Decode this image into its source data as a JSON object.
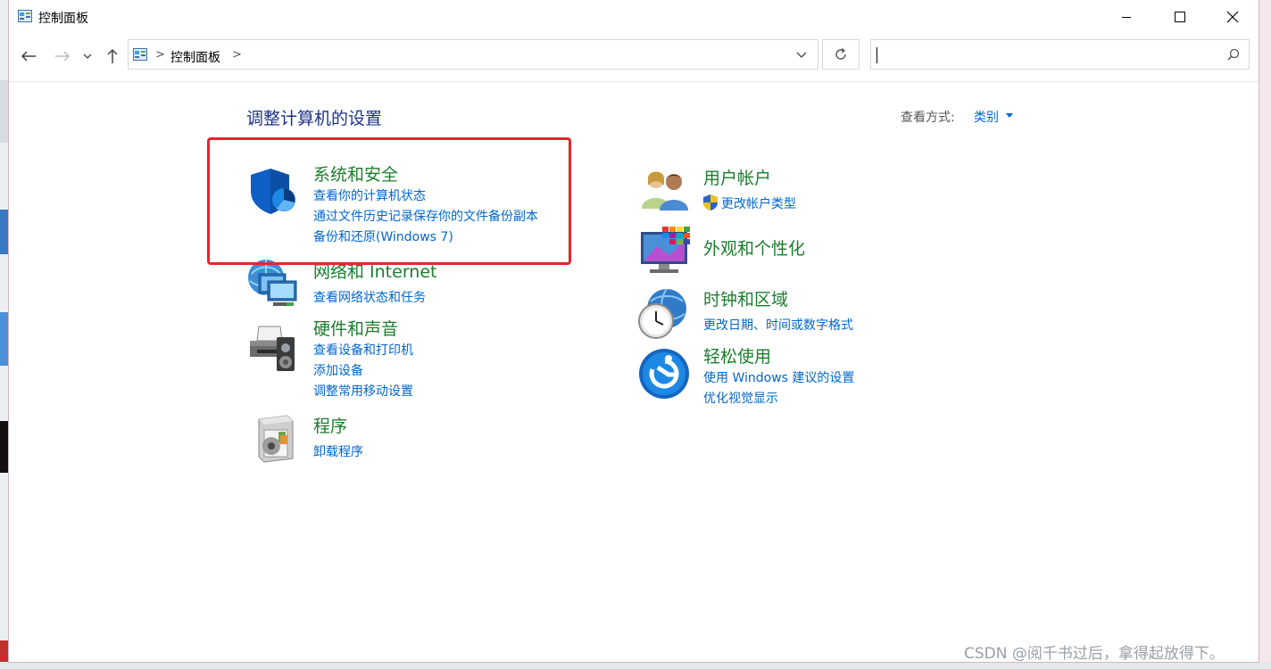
{
  "window": {
    "title": "控制面板"
  },
  "address": {
    "crumb": "控制面板",
    "sep": ">",
    "search_placeholder": ""
  },
  "page": {
    "title": "调整计算机的设置",
    "view_by_label": "查看方式:",
    "view_by_value": "类别"
  },
  "categories": [
    {
      "icon": "shield-icon",
      "title": "系统和安全",
      "links": [
        "查看你的计算机状态",
        "通过文件历史记录保存你的文件备份副本",
        "备份和还原(Windows 7)"
      ]
    },
    {
      "icon": "network-icon",
      "title": "网络和 Internet",
      "links": [
        "查看网络状态和任务"
      ]
    },
    {
      "icon": "printer-icon",
      "title": "硬件和声音",
      "links": [
        "查看设备和打印机",
        "添加设备",
        "调整常用移动设置"
      ]
    },
    {
      "icon": "programs-icon",
      "title": "程序",
      "links": [
        "卸载程序"
      ]
    },
    {
      "icon": "users-icon",
      "title": "用户帐户",
      "links": [
        "更改帐户类型"
      ]
    },
    {
      "icon": "appearance-icon",
      "title": "外观和个性化",
      "links": []
    },
    {
      "icon": "clock-globe-icon",
      "title": "时钟和区域",
      "links": [
        "更改日期、时间或数字格式"
      ]
    },
    {
      "icon": "ease-of-access-icon",
      "title": "轻松使用",
      "links": [
        "使用 Windows 建议的设置",
        "优化视觉显示"
      ]
    }
  ],
  "watermark": "CSDN @阅千书过后，拿得起放得下。",
  "colors": {
    "title_green": "#1b7d2d",
    "link_blue": "#0066cc",
    "heading_blue": "#1e3287",
    "highlight_red": "#e8242c"
  }
}
